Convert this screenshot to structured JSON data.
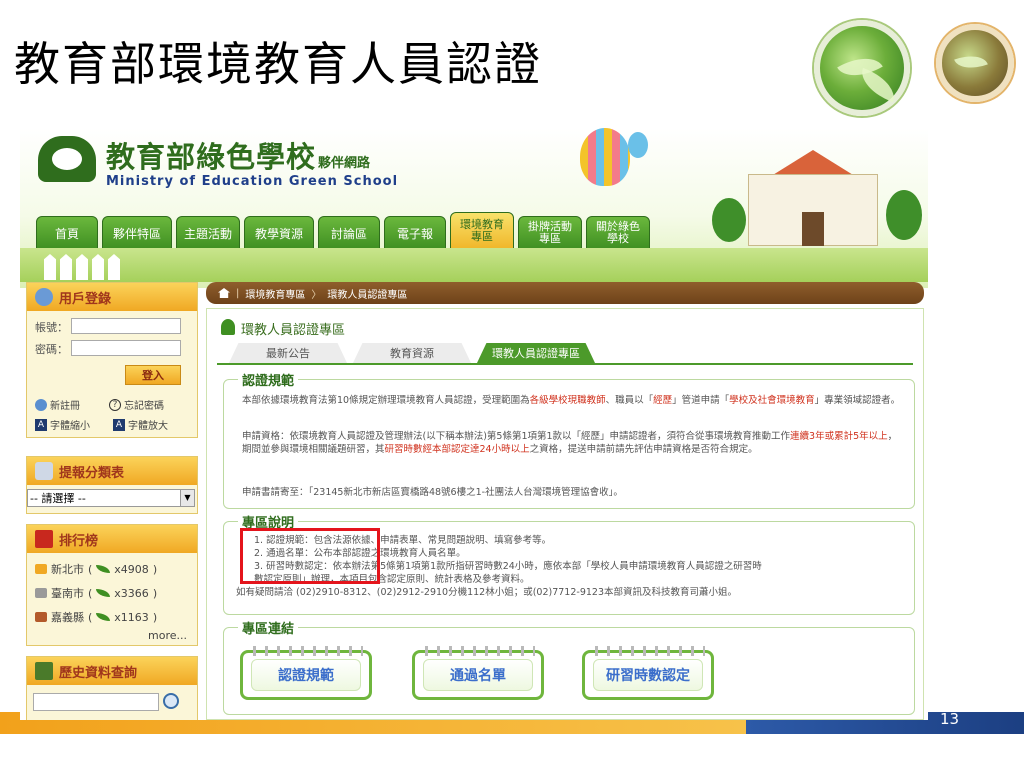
{
  "slide": {
    "title": "教育部環境教育人員認證",
    "page_number": "13"
  },
  "site": {
    "logo_title": "教育部綠色學校",
    "logo_sub": "夥伴網路",
    "logo_en": "Ministry of Education Green School",
    "nav": [
      {
        "label": "首頁"
      },
      {
        "label": "夥伴特區"
      },
      {
        "label": "主題活動"
      },
      {
        "label": "教學資源"
      },
      {
        "label": "討論區"
      },
      {
        "label": "電子報"
      },
      {
        "label": "環境教育專區",
        "active": true
      },
      {
        "label": "掛牌活動專區"
      },
      {
        "label": "關於綠色學校"
      }
    ],
    "sidebar": {
      "login": {
        "title": "用戶登錄",
        "account_label": "帳號：",
        "password_label": "密碼：",
        "login_button": "登入",
        "register": "新註冊",
        "forgot": "忘記密碼",
        "font_small": "字體縮小",
        "font_large": "字體放大"
      },
      "report": {
        "title": "提報分類表",
        "select_value": "-- 請選擇 --"
      },
      "ranking": {
        "title": "排行榜",
        "items": [
          {
            "name": "新北市",
            "count": "x4908"
          },
          {
            "name": "臺南市",
            "count": "x3366"
          },
          {
            "name": "嘉義縣",
            "count": "x1163"
          }
        ],
        "more": "more..."
      },
      "history": {
        "title": "歷史資料查詢"
      }
    },
    "breadcrumb": [
      "環境教育專區",
      "環教人員認證專區"
    ],
    "main": {
      "title": "環教人員認證專區",
      "tabs": [
        {
          "label": "最新公告"
        },
        {
          "label": "教育資源"
        },
        {
          "label": "環教人員認證專區",
          "active": true
        }
      ],
      "rules": {
        "title": "認證規範",
        "p1_a": "本部依據環境教育法第10條規定辦理環境教育人員認證，受理範圍為",
        "p1_hl1": "各級學校現職教師",
        "p1_b": "、職員以「",
        "p1_hl2": "經歷",
        "p1_c": "」管道申請「",
        "p1_hl3": "學校及社會環境教育",
        "p1_d": "」專業領域認證者。",
        "p2_a": "申請資格：依環境教育人員認證及管理辦法(以下稱本辦法)第5條第1項第1款以「經歷」申請認證者，須符合從事環境教育推動工作",
        "p2_hl1": "連續3年或累計5年以上",
        "p2_b": "，期間並參與環境相關議題研習，其",
        "p2_hl2": "研習時數經本部認定達24小時以上",
        "p2_c": "之資格，提送申請前請先評估申請資格是否符合規定。",
        "p3": "申請書請寄至：「23145新北市新店區寶橋路48號6樓之1-社團法人台灣環境管理協會收」。"
      },
      "desc": {
        "title": "專區說明",
        "lines": [
          "1. 認證規範：包含法源依據、申請表單、常見問題說明、填寫參考等。",
          "2. 通過名單：公布本部認證之環境教育人員名單。",
          "3. 研習時數認定：依本辦法第5條第1項第1款所指研習時數24小時，應依本部「學校人員申請環境教育人員認證之研習時",
          "    數認定原則」辦理，本項目包含認定原則、統計表格及參考資料。",
          "如有疑問請洽 (02)2910-8312、(02)2912-2910分機112林小姐；或(02)7712-9123本部資訊及科技教育司蕭小姐。"
        ]
      },
      "links": {
        "title": "專區連結",
        "items": [
          {
            "label": "認證規範"
          },
          {
            "label": "通過名單"
          },
          {
            "label": "研習時數認定"
          }
        ]
      }
    }
  },
  "colors": {
    "brand_green": "#2f6d1d",
    "highlight_red": "#e4141b",
    "accent_orange": "#f0a823",
    "bar_blue": "#2d5aa8"
  }
}
